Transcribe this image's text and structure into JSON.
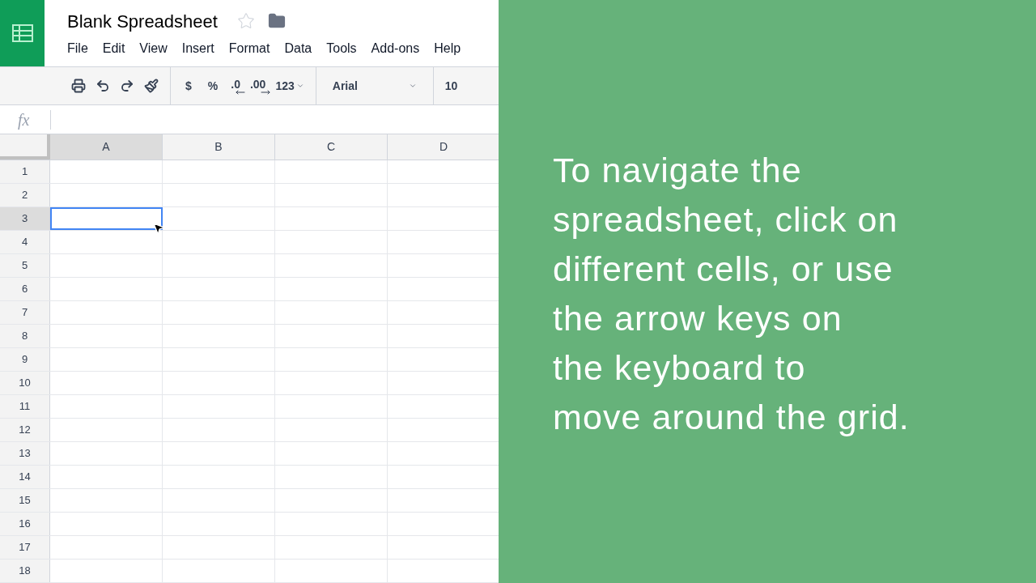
{
  "document": {
    "title": "Blank Spreadsheet",
    "starred": false
  },
  "menu": [
    "File",
    "Edit",
    "View",
    "Insert",
    "Format",
    "Data",
    "Tools",
    "Add-ons",
    "Help"
  ],
  "toolbar": [
    {
      "kind": "print"
    },
    {
      "kind": "undo"
    },
    {
      "kind": "redo"
    },
    {
      "kind": "paint-format"
    },
    {
      "kind": "separator"
    },
    {
      "kind": "text",
      "label": "$"
    },
    {
      "kind": "text",
      "label": "%"
    },
    {
      "kind": "decimal-decrease",
      "label": ".0"
    },
    {
      "kind": "decimal-increase",
      "label": ".00"
    },
    {
      "kind": "dropdown",
      "label": "123"
    },
    {
      "kind": "separator"
    },
    {
      "kind": "font",
      "label": "Arial"
    },
    {
      "kind": "separator"
    },
    {
      "kind": "font-size",
      "label": "10"
    }
  ],
  "formula_bar": {
    "label": "fx"
  },
  "columns": [
    {
      "label": "A",
      "selected": true
    },
    {
      "label": "B",
      "selected": false
    },
    {
      "label": "C",
      "selected": false
    },
    {
      "label": "D",
      "selected": false
    }
  ],
  "rows": [
    {
      "label": "1",
      "selected": false
    },
    {
      "label": "2",
      "selected": false
    },
    {
      "label": "3",
      "selected": true
    },
    {
      "label": "4",
      "selected": false
    },
    {
      "label": "5",
      "selected": false
    },
    {
      "label": "6",
      "selected": false
    },
    {
      "label": "7",
      "selected": false
    },
    {
      "label": "8",
      "selected": false
    },
    {
      "label": "9",
      "selected": false
    },
    {
      "label": "10",
      "selected": false
    },
    {
      "label": "11",
      "selected": false
    },
    {
      "label": "12",
      "selected": false
    },
    {
      "label": "13",
      "selected": false
    },
    {
      "label": "14",
      "selected": false
    },
    {
      "label": "15",
      "selected": false
    },
    {
      "label": "16",
      "selected": false
    },
    {
      "label": "17",
      "selected": false
    },
    {
      "label": "18",
      "selected": false
    }
  ],
  "overlay": {
    "text": "To navigate the\nspreadsheet, click on\ndifferent cells, or use\nthe arrow keys on\nthe keyboard to\nmove around the grid."
  }
}
